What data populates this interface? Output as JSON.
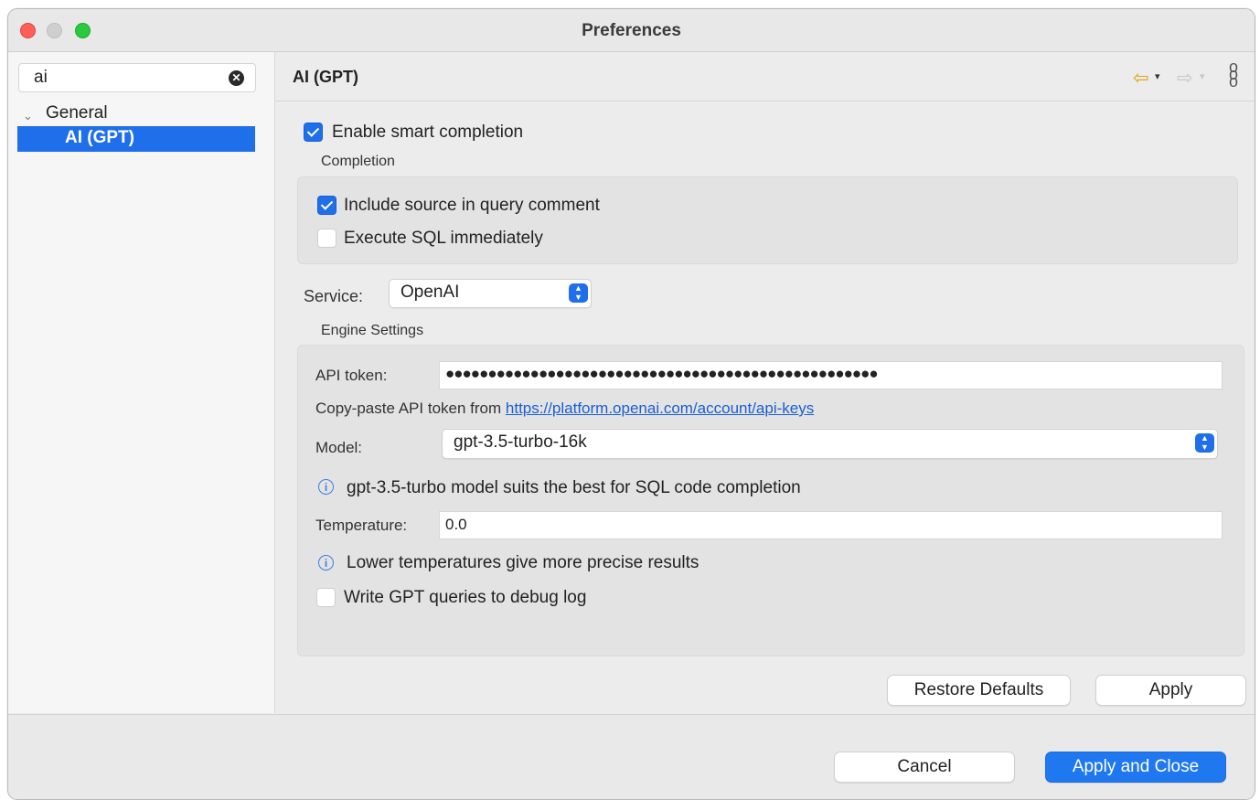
{
  "window": {
    "title": "Preferences"
  },
  "sidebar": {
    "search_value": "ai",
    "tree": {
      "parent": "General",
      "selected": "AI (GPT)"
    }
  },
  "page": {
    "title": "AI (GPT)",
    "enable_smart_completion": {
      "label": "Enable smart completion",
      "checked": true
    },
    "completion": {
      "group_label": "Completion",
      "include_source": {
        "label": "Include source in query comment",
        "checked": true
      },
      "execute_sql": {
        "label": "Execute SQL immediately",
        "checked": false
      }
    },
    "service": {
      "label": "Service:",
      "value": "OpenAI"
    },
    "engine": {
      "group_label": "Engine Settings",
      "api_token_label": "API token:",
      "api_token_value": "●●●●●●●●●●●●●●●●●●●●●●●●●●●●●●●●●●●●●●●●●●●●●●●●●●●",
      "copy_hint": "Copy-paste API token from",
      "copy_link": "https://platform.openai.com/account/api-keys",
      "model_label": "Model:",
      "model_value": "gpt-3.5-turbo-16k",
      "model_info": "gpt-3.5-turbo model suits the best for SQL code completion",
      "temperature_label": "Temperature:",
      "temperature_value": "0.0",
      "temperature_info": "Lower temperatures give more precise results",
      "debug_log": {
        "label": "Write GPT queries to debug log",
        "checked": false
      }
    },
    "buttons": {
      "restore_defaults": "Restore Defaults",
      "apply": "Apply"
    }
  },
  "footer": {
    "cancel": "Cancel",
    "apply_and_close": "Apply and Close"
  },
  "icons": {
    "back": "arrow-left-icon",
    "forward": "arrow-right-icon",
    "menu": "vertical-menu-icon",
    "clear": "clear-icon",
    "chevron": "chevron-down-icon",
    "info": "info-icon"
  },
  "colors": {
    "accent": "#1f6feb",
    "nav_back": "#e2a40f",
    "link": "#1a5fd0"
  }
}
